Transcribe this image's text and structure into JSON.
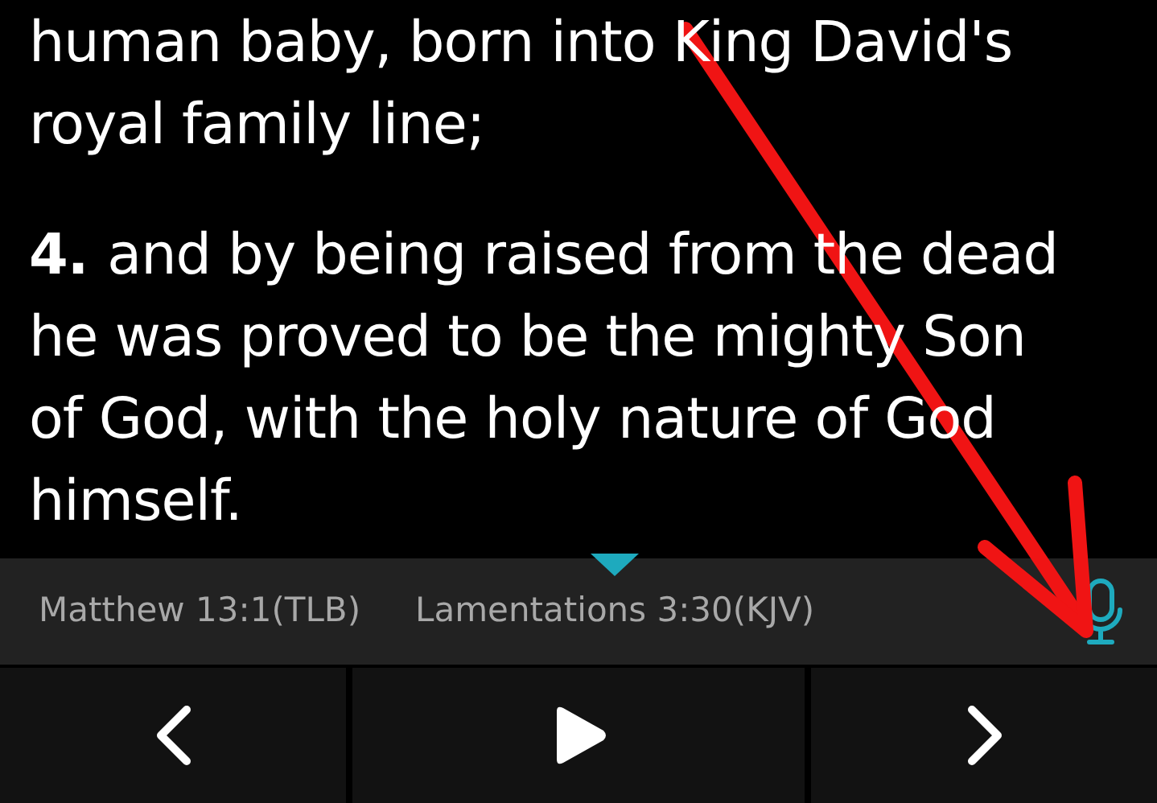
{
  "verses": [
    {
      "lines": [
        "human baby, born into King David's",
        "royal family line;"
      ]
    },
    {
      "number": "4.",
      "lines": [
        "and by being raised from the dead",
        "he was proved to be the mighty Son",
        "of God, with the holy nature of God",
        "himself."
      ]
    }
  ],
  "references": [
    {
      "label": "Matthew 13:1(TLB)",
      "selected": false
    },
    {
      "label": "Lamentations 3:30(KJV)",
      "selected": true
    }
  ],
  "annotation": {
    "kind": "arrow"
  }
}
